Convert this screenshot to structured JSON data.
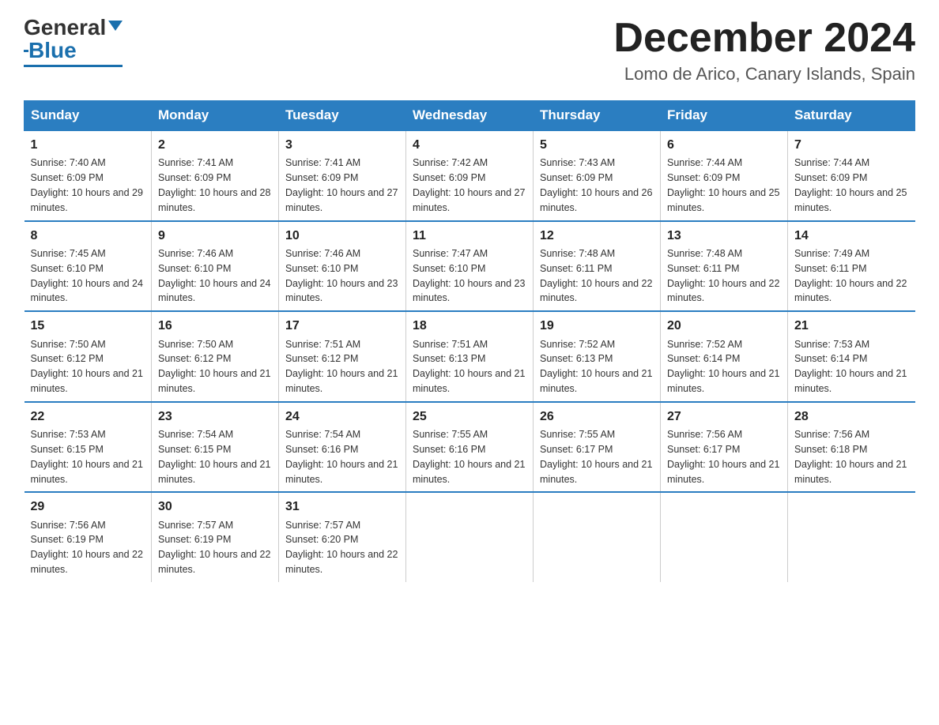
{
  "header": {
    "logo_text_general": "General",
    "logo_text_blue": "Blue",
    "month_title": "December 2024",
    "location": "Lomo de Arico, Canary Islands, Spain"
  },
  "days_of_week": [
    "Sunday",
    "Monday",
    "Tuesday",
    "Wednesday",
    "Thursday",
    "Friday",
    "Saturday"
  ],
  "weeks": [
    [
      {
        "day": "1",
        "sunrise": "7:40 AM",
        "sunset": "6:09 PM",
        "daylight": "10 hours and 29 minutes."
      },
      {
        "day": "2",
        "sunrise": "7:41 AM",
        "sunset": "6:09 PM",
        "daylight": "10 hours and 28 minutes."
      },
      {
        "day": "3",
        "sunrise": "7:41 AM",
        "sunset": "6:09 PM",
        "daylight": "10 hours and 27 minutes."
      },
      {
        "day": "4",
        "sunrise": "7:42 AM",
        "sunset": "6:09 PM",
        "daylight": "10 hours and 27 minutes."
      },
      {
        "day": "5",
        "sunrise": "7:43 AM",
        "sunset": "6:09 PM",
        "daylight": "10 hours and 26 minutes."
      },
      {
        "day": "6",
        "sunrise": "7:44 AM",
        "sunset": "6:09 PM",
        "daylight": "10 hours and 25 minutes."
      },
      {
        "day": "7",
        "sunrise": "7:44 AM",
        "sunset": "6:09 PM",
        "daylight": "10 hours and 25 minutes."
      }
    ],
    [
      {
        "day": "8",
        "sunrise": "7:45 AM",
        "sunset": "6:10 PM",
        "daylight": "10 hours and 24 minutes."
      },
      {
        "day": "9",
        "sunrise": "7:46 AM",
        "sunset": "6:10 PM",
        "daylight": "10 hours and 24 minutes."
      },
      {
        "day": "10",
        "sunrise": "7:46 AM",
        "sunset": "6:10 PM",
        "daylight": "10 hours and 23 minutes."
      },
      {
        "day": "11",
        "sunrise": "7:47 AM",
        "sunset": "6:10 PM",
        "daylight": "10 hours and 23 minutes."
      },
      {
        "day": "12",
        "sunrise": "7:48 AM",
        "sunset": "6:11 PM",
        "daylight": "10 hours and 22 minutes."
      },
      {
        "day": "13",
        "sunrise": "7:48 AM",
        "sunset": "6:11 PM",
        "daylight": "10 hours and 22 minutes."
      },
      {
        "day": "14",
        "sunrise": "7:49 AM",
        "sunset": "6:11 PM",
        "daylight": "10 hours and 22 minutes."
      }
    ],
    [
      {
        "day": "15",
        "sunrise": "7:50 AM",
        "sunset": "6:12 PM",
        "daylight": "10 hours and 21 minutes."
      },
      {
        "day": "16",
        "sunrise": "7:50 AM",
        "sunset": "6:12 PM",
        "daylight": "10 hours and 21 minutes."
      },
      {
        "day": "17",
        "sunrise": "7:51 AM",
        "sunset": "6:12 PM",
        "daylight": "10 hours and 21 minutes."
      },
      {
        "day": "18",
        "sunrise": "7:51 AM",
        "sunset": "6:13 PM",
        "daylight": "10 hours and 21 minutes."
      },
      {
        "day": "19",
        "sunrise": "7:52 AM",
        "sunset": "6:13 PM",
        "daylight": "10 hours and 21 minutes."
      },
      {
        "day": "20",
        "sunrise": "7:52 AM",
        "sunset": "6:14 PM",
        "daylight": "10 hours and 21 minutes."
      },
      {
        "day": "21",
        "sunrise": "7:53 AM",
        "sunset": "6:14 PM",
        "daylight": "10 hours and 21 minutes."
      }
    ],
    [
      {
        "day": "22",
        "sunrise": "7:53 AM",
        "sunset": "6:15 PM",
        "daylight": "10 hours and 21 minutes."
      },
      {
        "day": "23",
        "sunrise": "7:54 AM",
        "sunset": "6:15 PM",
        "daylight": "10 hours and 21 minutes."
      },
      {
        "day": "24",
        "sunrise": "7:54 AM",
        "sunset": "6:16 PM",
        "daylight": "10 hours and 21 minutes."
      },
      {
        "day": "25",
        "sunrise": "7:55 AM",
        "sunset": "6:16 PM",
        "daylight": "10 hours and 21 minutes."
      },
      {
        "day": "26",
        "sunrise": "7:55 AM",
        "sunset": "6:17 PM",
        "daylight": "10 hours and 21 minutes."
      },
      {
        "day": "27",
        "sunrise": "7:56 AM",
        "sunset": "6:17 PM",
        "daylight": "10 hours and 21 minutes."
      },
      {
        "day": "28",
        "sunrise": "7:56 AM",
        "sunset": "6:18 PM",
        "daylight": "10 hours and 21 minutes."
      }
    ],
    [
      {
        "day": "29",
        "sunrise": "7:56 AM",
        "sunset": "6:19 PM",
        "daylight": "10 hours and 22 minutes."
      },
      {
        "day": "30",
        "sunrise": "7:57 AM",
        "sunset": "6:19 PM",
        "daylight": "10 hours and 22 minutes."
      },
      {
        "day": "31",
        "sunrise": "7:57 AM",
        "sunset": "6:20 PM",
        "daylight": "10 hours and 22 minutes."
      },
      {
        "day": "",
        "sunrise": "",
        "sunset": "",
        "daylight": ""
      },
      {
        "day": "",
        "sunrise": "",
        "sunset": "",
        "daylight": ""
      },
      {
        "day": "",
        "sunrise": "",
        "sunset": "",
        "daylight": ""
      },
      {
        "day": "",
        "sunrise": "",
        "sunset": "",
        "daylight": ""
      }
    ]
  ]
}
